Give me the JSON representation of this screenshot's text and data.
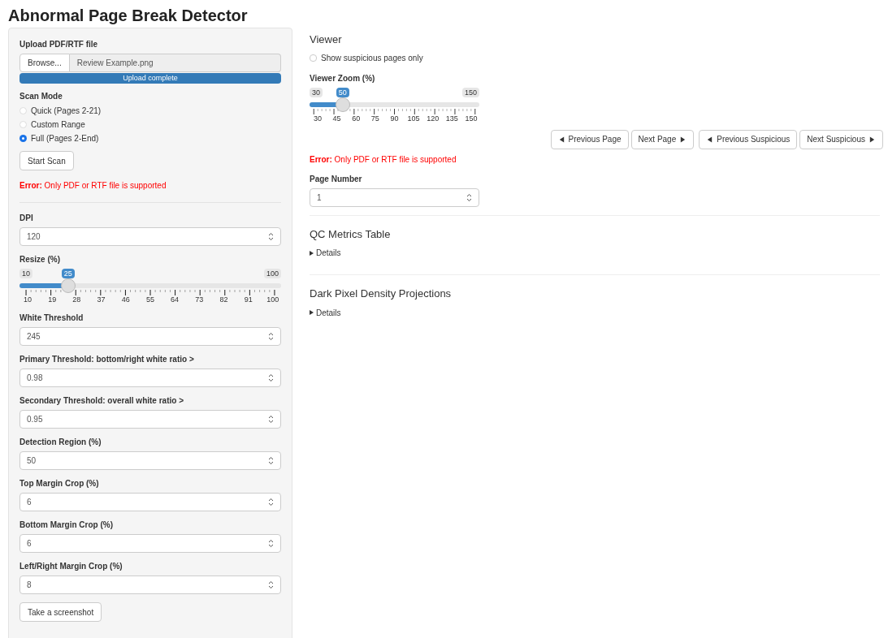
{
  "title": "Abnormal Page Break Detector",
  "sidebar": {
    "upload": {
      "label": "Upload PDF/RTF file",
      "browse": "Browse...",
      "filename": "Review Example.png",
      "progress": "Upload complete",
      "level": 1
    },
    "scan_mode": {
      "label": "Scan Mode",
      "options": [
        {
          "label": "Quick (Pages 2-21)",
          "selected": false
        },
        {
          "label": "Custom Range",
          "selected": false
        },
        {
          "label": "Full (Pages 2-End)",
          "selected": true
        }
      ]
    },
    "start_button": "Start Scan",
    "error": "**Error:** Only PDF or RTF file is supported",
    "settings": [
      {
        "kind": "number",
        "label": "DPI",
        "value": "120"
      },
      {
        "kind": "slider",
        "label": "Resize (%)",
        "min": "10",
        "max": "100",
        "value": "25",
        "level": 0.1667,
        "ticks": [
          "10",
          "19",
          "28",
          "37",
          "46",
          "55",
          "64",
          "73",
          "82",
          "91",
          "100"
        ]
      },
      {
        "kind": "number",
        "label": "White Threshold",
        "value": "245"
      },
      {
        "kind": "number",
        "label": "Primary Threshold: bottom/right white ratio >",
        "value": "0.98"
      },
      {
        "kind": "number",
        "label": "Secondary Threshold: overall white ratio >",
        "value": "0.95"
      },
      {
        "kind": "number",
        "label": "Detection Region (%)",
        "value": "50"
      },
      {
        "kind": "number",
        "label": "Top Margin Crop (%)",
        "value": "6"
      },
      {
        "kind": "number",
        "label": "Bottom Margin Crop (%)",
        "value": "6"
      },
      {
        "kind": "number",
        "label": "Left/Right Margin Crop (%)",
        "value": "8"
      }
    ],
    "screenshot_button": "Take a screenshot"
  },
  "viewer": {
    "heading": "Viewer",
    "suspicious_only": {
      "label": "Show suspicious pages only",
      "checked": false
    },
    "zoom": {
      "label": "Viewer Zoom (%)",
      "min": "30",
      "max": "150",
      "value": "50",
      "level": 0.1667,
      "ticks": [
        "30",
        "45",
        "60",
        "75",
        "90",
        "105",
        "120",
        "135",
        "150"
      ]
    },
    "nav_groups": [
      [
        {
          "label": "Previous Page",
          "kind": "back"
        },
        {
          "label": "Next Page",
          "kind": "forward"
        }
      ],
      [
        {
          "label": "Previous Suspicious",
          "kind": "back"
        },
        {
          "label": "Next Suspicious",
          "kind": "forward"
        }
      ]
    ],
    "error": "**Error:** Only PDF or RTF file is supported",
    "page_number": {
      "label": "Page Number",
      "value": "1"
    }
  },
  "sections": [
    {
      "heading": "QC Metrics Table",
      "details": "Details",
      "expanded": false
    },
    {
      "heading": "Dark Pixel Density Projections",
      "details": "Details",
      "expanded": false
    }
  ]
}
